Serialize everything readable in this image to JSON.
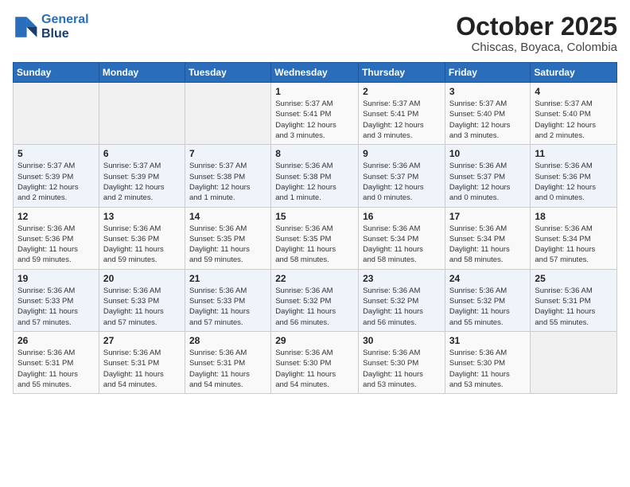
{
  "header": {
    "logo_line1": "General",
    "logo_line2": "Blue",
    "month": "October 2025",
    "location": "Chiscas, Boyaca, Colombia"
  },
  "weekdays": [
    "Sunday",
    "Monday",
    "Tuesday",
    "Wednesday",
    "Thursday",
    "Friday",
    "Saturday"
  ],
  "weeks": [
    [
      {
        "day": "",
        "info": ""
      },
      {
        "day": "",
        "info": ""
      },
      {
        "day": "",
        "info": ""
      },
      {
        "day": "1",
        "info": "Sunrise: 5:37 AM\nSunset: 5:41 PM\nDaylight: 12 hours\nand 3 minutes."
      },
      {
        "day": "2",
        "info": "Sunrise: 5:37 AM\nSunset: 5:41 PM\nDaylight: 12 hours\nand 3 minutes."
      },
      {
        "day": "3",
        "info": "Sunrise: 5:37 AM\nSunset: 5:40 PM\nDaylight: 12 hours\nand 3 minutes."
      },
      {
        "day": "4",
        "info": "Sunrise: 5:37 AM\nSunset: 5:40 PM\nDaylight: 12 hours\nand 2 minutes."
      }
    ],
    [
      {
        "day": "5",
        "info": "Sunrise: 5:37 AM\nSunset: 5:39 PM\nDaylight: 12 hours\nand 2 minutes."
      },
      {
        "day": "6",
        "info": "Sunrise: 5:37 AM\nSunset: 5:39 PM\nDaylight: 12 hours\nand 2 minutes."
      },
      {
        "day": "7",
        "info": "Sunrise: 5:37 AM\nSunset: 5:38 PM\nDaylight: 12 hours\nand 1 minute."
      },
      {
        "day": "8",
        "info": "Sunrise: 5:36 AM\nSunset: 5:38 PM\nDaylight: 12 hours\nand 1 minute."
      },
      {
        "day": "9",
        "info": "Sunrise: 5:36 AM\nSunset: 5:37 PM\nDaylight: 12 hours\nand 0 minutes."
      },
      {
        "day": "10",
        "info": "Sunrise: 5:36 AM\nSunset: 5:37 PM\nDaylight: 12 hours\nand 0 minutes."
      },
      {
        "day": "11",
        "info": "Sunrise: 5:36 AM\nSunset: 5:36 PM\nDaylight: 12 hours\nand 0 minutes."
      }
    ],
    [
      {
        "day": "12",
        "info": "Sunrise: 5:36 AM\nSunset: 5:36 PM\nDaylight: 11 hours\nand 59 minutes."
      },
      {
        "day": "13",
        "info": "Sunrise: 5:36 AM\nSunset: 5:36 PM\nDaylight: 11 hours\nand 59 minutes."
      },
      {
        "day": "14",
        "info": "Sunrise: 5:36 AM\nSunset: 5:35 PM\nDaylight: 11 hours\nand 59 minutes."
      },
      {
        "day": "15",
        "info": "Sunrise: 5:36 AM\nSunset: 5:35 PM\nDaylight: 11 hours\nand 58 minutes."
      },
      {
        "day": "16",
        "info": "Sunrise: 5:36 AM\nSunset: 5:34 PM\nDaylight: 11 hours\nand 58 minutes."
      },
      {
        "day": "17",
        "info": "Sunrise: 5:36 AM\nSunset: 5:34 PM\nDaylight: 11 hours\nand 58 minutes."
      },
      {
        "day": "18",
        "info": "Sunrise: 5:36 AM\nSunset: 5:34 PM\nDaylight: 11 hours\nand 57 minutes."
      }
    ],
    [
      {
        "day": "19",
        "info": "Sunrise: 5:36 AM\nSunset: 5:33 PM\nDaylight: 11 hours\nand 57 minutes."
      },
      {
        "day": "20",
        "info": "Sunrise: 5:36 AM\nSunset: 5:33 PM\nDaylight: 11 hours\nand 57 minutes."
      },
      {
        "day": "21",
        "info": "Sunrise: 5:36 AM\nSunset: 5:33 PM\nDaylight: 11 hours\nand 57 minutes."
      },
      {
        "day": "22",
        "info": "Sunrise: 5:36 AM\nSunset: 5:32 PM\nDaylight: 11 hours\nand 56 minutes."
      },
      {
        "day": "23",
        "info": "Sunrise: 5:36 AM\nSunset: 5:32 PM\nDaylight: 11 hours\nand 56 minutes."
      },
      {
        "day": "24",
        "info": "Sunrise: 5:36 AM\nSunset: 5:32 PM\nDaylight: 11 hours\nand 55 minutes."
      },
      {
        "day": "25",
        "info": "Sunrise: 5:36 AM\nSunset: 5:31 PM\nDaylight: 11 hours\nand 55 minutes."
      }
    ],
    [
      {
        "day": "26",
        "info": "Sunrise: 5:36 AM\nSunset: 5:31 PM\nDaylight: 11 hours\nand 55 minutes."
      },
      {
        "day": "27",
        "info": "Sunrise: 5:36 AM\nSunset: 5:31 PM\nDaylight: 11 hours\nand 54 minutes."
      },
      {
        "day": "28",
        "info": "Sunrise: 5:36 AM\nSunset: 5:31 PM\nDaylight: 11 hours\nand 54 minutes."
      },
      {
        "day": "29",
        "info": "Sunrise: 5:36 AM\nSunset: 5:30 PM\nDaylight: 11 hours\nand 54 minutes."
      },
      {
        "day": "30",
        "info": "Sunrise: 5:36 AM\nSunset: 5:30 PM\nDaylight: 11 hours\nand 53 minutes."
      },
      {
        "day": "31",
        "info": "Sunrise: 5:36 AM\nSunset: 5:30 PM\nDaylight: 11 hours\nand 53 minutes."
      },
      {
        "day": "",
        "info": ""
      }
    ]
  ]
}
